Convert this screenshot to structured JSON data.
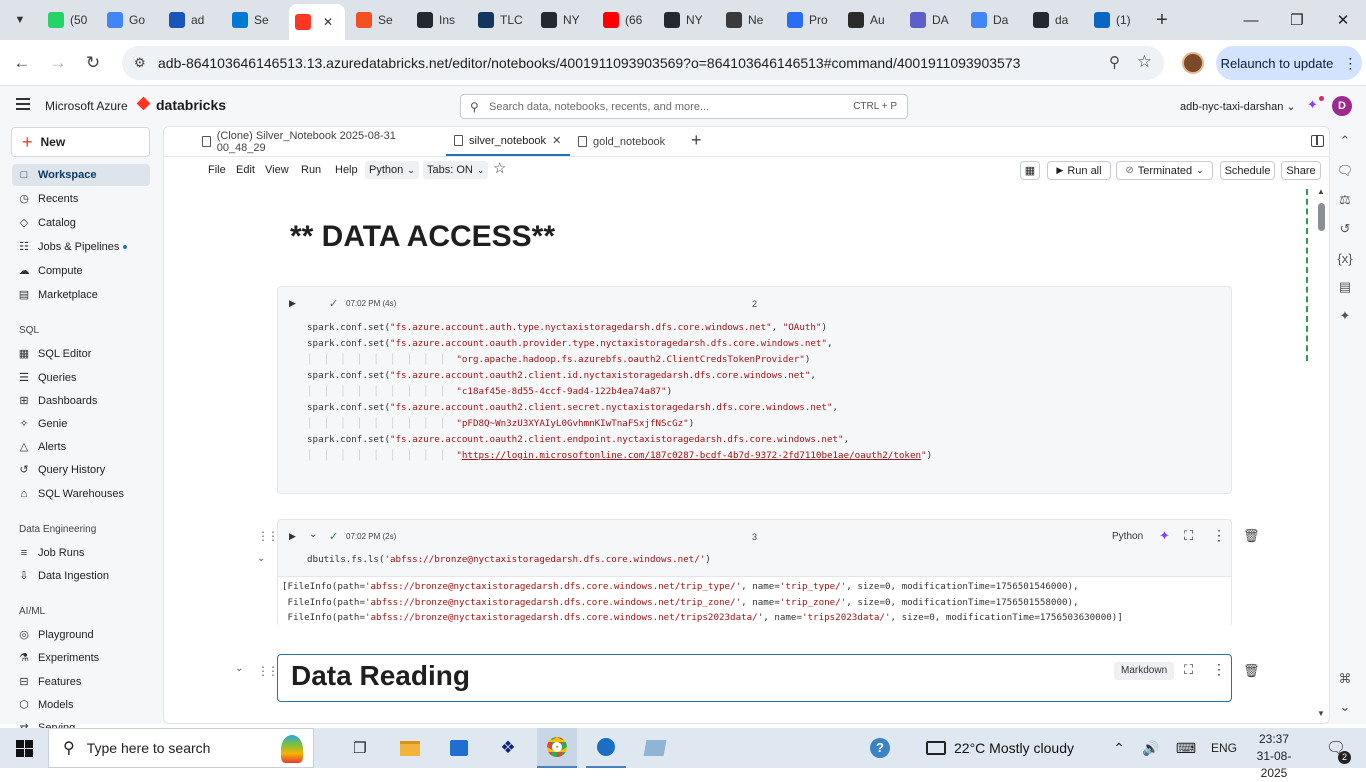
{
  "browser": {
    "tabs": [
      {
        "label": "(50",
        "color": "#25d366"
      },
      {
        "label": "Go",
        "color": "#4285f4"
      },
      {
        "label": "ad",
        "color": "#1a56b8"
      },
      {
        "label": "Se",
        "color": "#0078d4"
      },
      {
        "label": "",
        "color": "#ff3621",
        "active": true
      },
      {
        "label": "Se",
        "color": "#f25022"
      },
      {
        "label": "Ins",
        "color": "#24292f"
      },
      {
        "label": "TLC",
        "color": "#14365d"
      },
      {
        "label": "NY",
        "color": "#24292f"
      },
      {
        "label": "(66",
        "color": "#ff0000"
      },
      {
        "label": "NY",
        "color": "#24292f"
      },
      {
        "label": "Ne",
        "color": "#3a3a3a"
      },
      {
        "label": "Pro",
        "color": "#2b6cf0"
      },
      {
        "label": "Au",
        "color": "#2b2b2b"
      },
      {
        "label": "DA",
        "color": "#5b5fc7"
      },
      {
        "label": "Da",
        "color": "#4285f4"
      },
      {
        "label": "da",
        "color": "#24292f"
      },
      {
        "label": "(1)",
        "color": "#0a66c2"
      }
    ],
    "new_tab": "+",
    "url": "adb-864103646146513.13.azuredatabricks.net/editor/notebooks/4001911093903569?o=864103646146513#command/4001911093903573",
    "relaunch_label": "Relaunch to update"
  },
  "header": {
    "brand": "Microsoft Azure",
    "product": "databricks",
    "search_placeholder": "Search data, notebooks, recents, and more...",
    "search_shortcut": "CTRL + P",
    "workspace": "adb-nyc-taxi-darshan",
    "avatar": "D"
  },
  "sidebar": {
    "new_label": "New",
    "items_top": [
      {
        "label": "Workspace",
        "icon": "folder-icon",
        "active": true
      },
      {
        "label": "Recents",
        "icon": "clock-icon"
      },
      {
        "label": "Catalog",
        "icon": "catalog-icon"
      },
      {
        "label": "Jobs & Pipelines",
        "icon": "jobs-icon",
        "dot": true
      },
      {
        "label": "Compute",
        "icon": "cloud-icon"
      },
      {
        "label": "Marketplace",
        "icon": "store-icon"
      }
    ],
    "sql_heading": "SQL",
    "items_sql": [
      {
        "label": "SQL Editor",
        "icon": "editor-icon"
      },
      {
        "label": "Queries",
        "icon": "query-icon"
      },
      {
        "label": "Dashboards",
        "icon": "dashboard-icon"
      },
      {
        "label": "Genie",
        "icon": "genie-icon"
      },
      {
        "label": "Alerts",
        "icon": "bell-icon"
      },
      {
        "label": "Query History",
        "icon": "history-icon"
      },
      {
        "label": "SQL Warehouses",
        "icon": "warehouse-icon"
      }
    ],
    "de_heading": "Data Engineering",
    "items_de": [
      {
        "label": "Job Runs",
        "icon": "list-icon"
      },
      {
        "label": "Data Ingestion",
        "icon": "ingest-icon"
      }
    ],
    "ml_heading": "AI/ML",
    "items_ml": [
      {
        "label": "Playground",
        "icon": "playground-icon"
      },
      {
        "label": "Experiments",
        "icon": "flask-icon"
      },
      {
        "label": "Features",
        "icon": "features-icon"
      },
      {
        "label": "Models",
        "icon": "model-icon"
      },
      {
        "label": "Serving",
        "icon": "serving-icon"
      }
    ]
  },
  "notebook": {
    "tabs": [
      {
        "label": "(Clone) Silver_Notebook 2025-08-31 00_48_29"
      },
      {
        "label": "silver_notebook",
        "active": true
      },
      {
        "label": "gold_notebook"
      }
    ],
    "menu": [
      "File",
      "Edit",
      "View",
      "Run",
      "Help"
    ],
    "language": "Python",
    "tabs_setting": "Tabs: ON",
    "run_all": "Run all",
    "cluster_status": "Terminated",
    "schedule": "Schedule",
    "share": "Share",
    "title_heading": "** DATA ACCESS**",
    "cell2": {
      "status": "07:02 PM (4s)",
      "number": "2",
      "lines": [
        {
          "indent": false,
          "pre": "spark.conf.set(",
          "s1": "\"fs.azure.account.auth.type.nyctaxistoragedarsh.dfs.core.windows.net\"",
          "mid": ", ",
          "s2": "\"OAuth\"",
          "post": ")"
        },
        {
          "indent": false,
          "pre": "spark.conf.set(",
          "s1": "\"fs.azure.account.oauth.provider.type.nyctaxistoragedarsh.dfs.core.windows.net\"",
          "mid": ",",
          "s2": "",
          "post": ""
        },
        {
          "indent": true,
          "pre": "",
          "s1": "\"org.apache.hadoop.fs.azurebfs.oauth2.ClientCredsTokenProvider\"",
          "mid": "",
          "s2": "",
          "post": ")"
        },
        {
          "indent": false,
          "pre": "spark.conf.set(",
          "s1": "\"fs.azure.account.oauth2.client.id.nyctaxistoragedarsh.dfs.core.windows.net\"",
          "mid": ",",
          "s2": "",
          "post": ""
        },
        {
          "indent": true,
          "pre": "",
          "s1": "\"c18af45e-8d55-4ccf-9ad4-122b4ea74a87\"",
          "mid": "",
          "s2": "",
          "post": ")"
        },
        {
          "indent": false,
          "pre": "spark.conf.set(",
          "s1": "\"fs.azure.account.oauth2.client.secret.nyctaxistoragedarsh.dfs.core.windows.net\"",
          "mid": ",",
          "s2": "",
          "post": ""
        },
        {
          "indent": true,
          "pre": "",
          "s1": "\"pFD8Q~Wn3zU3XYAIyL0GvhmnKIwTnaFSxjfNScGz\"",
          "mid": "",
          "s2": "",
          "post": ")"
        },
        {
          "indent": false,
          "pre": "spark.conf.set(",
          "s1": "\"fs.azure.account.oauth2.client.endpoint.nyctaxistoragedarsh.dfs.core.windows.net\"",
          "mid": ",",
          "s2": "",
          "post": ""
        },
        {
          "indent": true,
          "pre": "",
          "s1": "\"",
          "link": "https://login.microsoftonline.com/187c0287-bcdf-4b7d-9372-2fd7110be1ae/oauth2/token",
          "s2": "\"",
          "post": ")"
        }
      ]
    },
    "cell3": {
      "status": "07:02 PM (2s)",
      "number": "3",
      "language": "Python",
      "code_pre": "dbutils.fs.ls(",
      "code_str": "'abfss://bronze@nyctaxistoragedarsh.dfs.core.windows.net/'",
      "code_post": ")",
      "output": [
        {
          "a": "[FileInfo(path=",
          "b": "'abfss://bronze@nyctaxistoragedarsh.dfs.core.windows.net/trip_type/'",
          "c": ", name=",
          "d": "'trip_type/'",
          "e": ", size=0, modificationTime=1756501546000),"
        },
        {
          "a": " FileInfo(path=",
          "b": "'abfss://bronze@nyctaxistoragedarsh.dfs.core.windows.net/trip_zone/'",
          "c": ", name=",
          "d": "'trip_zone/'",
          "e": ", size=0, modificationTime=1756501558000),"
        },
        {
          "a": " FileInfo(path=",
          "b": "'abfss://bronze@nyctaxistoragedarsh.dfs.core.windows.net/trips2023data/'",
          "c": ", name=",
          "d": "'trips2023data/'",
          "e": ", size=0, modificationTime=1756503630000)]"
        }
      ]
    },
    "cell4": {
      "heading": "Data Reading",
      "type": "Markdown"
    }
  },
  "taskbar": {
    "search_placeholder": "Type here to search",
    "weather": "22°C  Mostly cloudy",
    "language": "ENG",
    "time": "23:37",
    "date": "31-08-2025",
    "notifications": "2"
  }
}
